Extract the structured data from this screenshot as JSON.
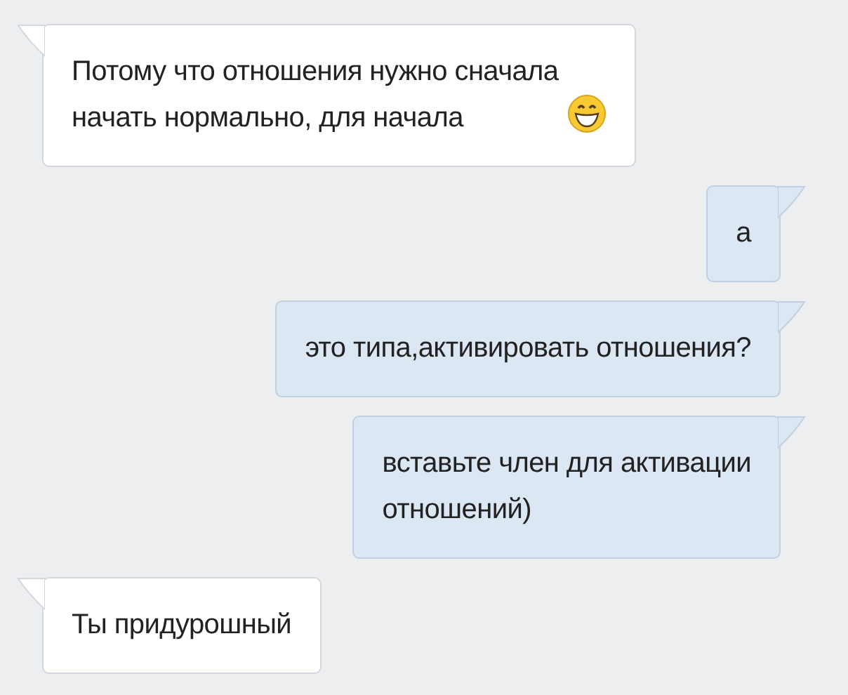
{
  "messages": [
    {
      "kind": "incoming_emoji",
      "text": "Потому что отношения нужно сначала\nначать нормально, для начала"
    },
    {
      "kind": "outgoing",
      "text": "а"
    },
    {
      "kind": "outgoing",
      "text": "это типа,активировать отношения?"
    },
    {
      "kind": "outgoing",
      "text": "вставьте член для активации\nотношений)"
    },
    {
      "kind": "incoming",
      "text": "Ты придурошный"
    }
  ]
}
